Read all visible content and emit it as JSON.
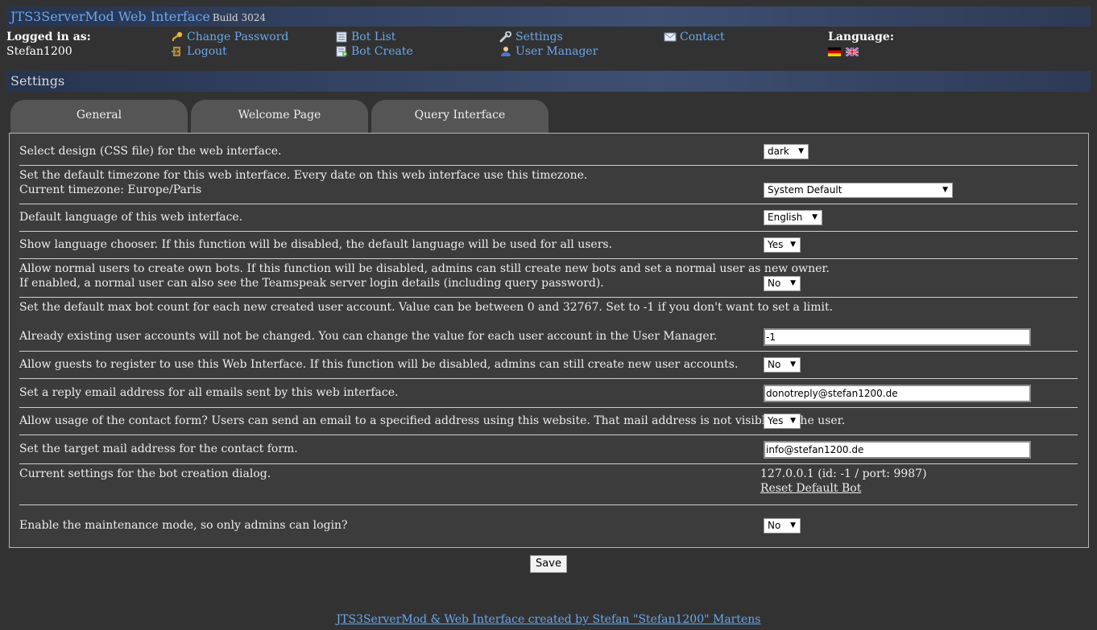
{
  "header": {
    "title": "JTS3ServerMod Web Interface",
    "build": "Build 3024"
  },
  "nav": {
    "logged_in_label": "Logged in as:",
    "username": "Stefan1200",
    "change_password": "Change Password",
    "logout": "Logout",
    "bot_list": "Bot List",
    "bot_create": "Bot Create",
    "settings": "Settings",
    "user_manager": "User Manager",
    "contact": "Contact",
    "language_label": "Language:",
    "icons": [
      "key-icon",
      "logout-icon",
      "list-icon",
      "create-icon",
      "wrench-icon",
      "user-icon",
      "mail-icon",
      "flag-de-icon",
      "flag-uk-icon"
    ]
  },
  "section_title": "Settings",
  "tabs": [
    "General",
    "Welcome Page",
    "Query Interface"
  ],
  "settings": {
    "design": {
      "label": "Select design (CSS file) for the web interface.",
      "value": "dark"
    },
    "timezone": {
      "label1": "Set the default timezone for this web interface. Every date on this web interface use this timezone.",
      "label2": "Current timezone: Europe/Paris",
      "value": "System Default"
    },
    "language": {
      "label": "Default language of this web interface.",
      "value": "English"
    },
    "chooser": {
      "label": "Show language chooser. If this function will be disabled, the default language will be used for all users.",
      "value": "Yes"
    },
    "own_bots": {
      "label1": "Allow normal users to create own bots. If this function will be disabled, admins can still create new bots and set a normal user as new owner.",
      "label2": "If enabled, a normal user can also see the Teamspeak server login details (including query password).",
      "value": "No"
    },
    "max_bots": {
      "label1": "Set the default max bot count for each new created user account. Value can be between 0 and 32767. Set to -1 if you don't want to set a limit.",
      "label2": "Already existing user accounts will not be changed. You can change the value for each user account in the User Manager.",
      "value": "-1"
    },
    "register": {
      "label": "Allow guests to register to use this Web Interface. If this function will be disabled, admins can still create new user accounts.",
      "value": "No"
    },
    "reply_email": {
      "label": "Set a reply email address for all emails sent by this web interface.",
      "value": "donotreply@stefan1200.de"
    },
    "contact_form": {
      "label": "Allow usage of the contact form? Users can send an email to a specified address using this website. That mail address is not visible for the user.",
      "value": "Yes"
    },
    "contact_email": {
      "label": "Set the target mail address for the contact form.",
      "value": "info@stefan1200.de"
    },
    "bot_creation": {
      "label": "Current settings for the bot creation dialog.",
      "info": "127.0.0.1 (id: -1 / port: 9987)",
      "reset_link": "Reset Default Bot"
    },
    "maintenance": {
      "label": "Enable the maintenance mode, so only admins can login?",
      "value": "No"
    }
  },
  "save_label": "Save",
  "footer": "JTS3ServerMod & Web Interface created by Stefan \"Stefan1200\" Martens"
}
